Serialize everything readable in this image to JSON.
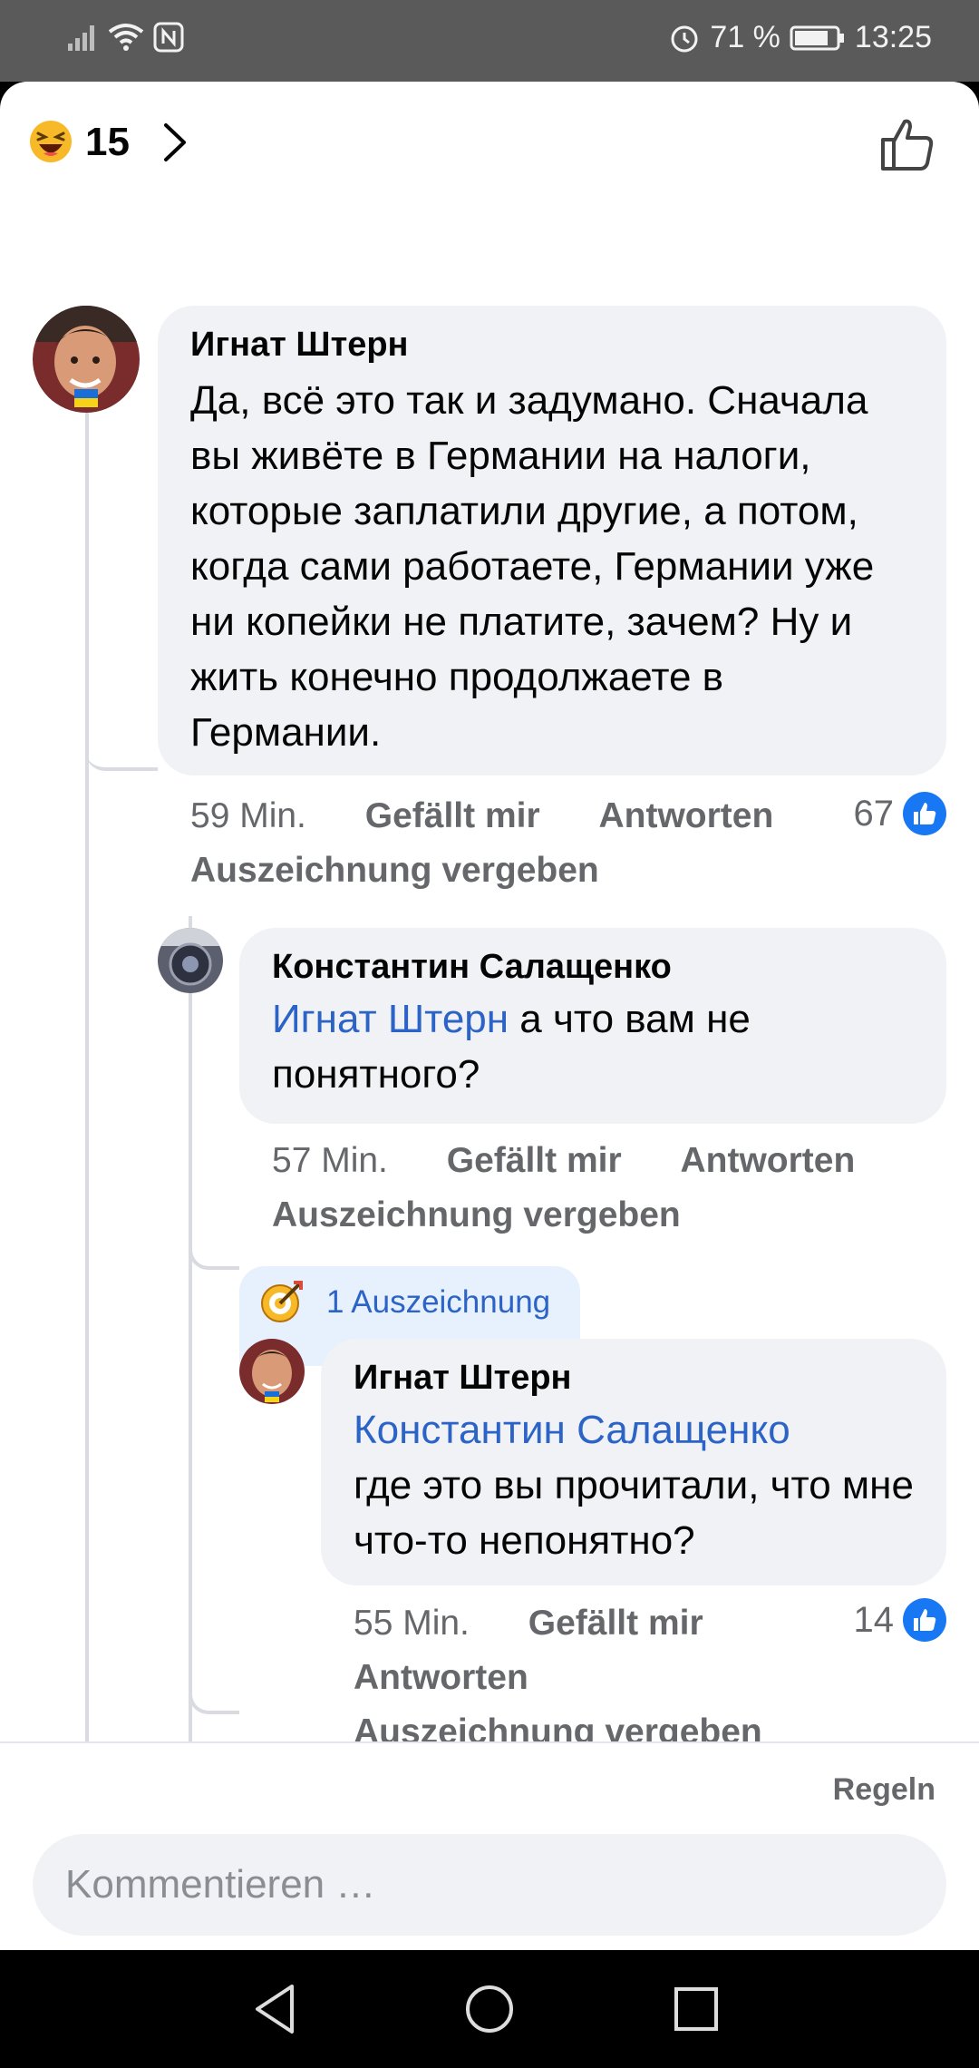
{
  "status_bar": {
    "battery": "71 %",
    "time": "13:25"
  },
  "reactions": {
    "count": "15",
    "emoji": "laughing-emoji"
  },
  "comments": [
    {
      "author": "Игнат Штерн",
      "text": "Да, всё это так и задумано. Сначала вы живёте в Германии на налоги, которые заплатили другие, а потом, когда сами работаете, Германии уже ни копейки не платите, зачем? Ну и жить конечно продолжаете в Германии.",
      "time": "59 Min.",
      "like_label": "Gefällt mir",
      "reply_label": "Antworten",
      "award_label": "Auszeichnung vergeben",
      "likes": "67"
    },
    {
      "author": "Константин Салащенко",
      "mention": "Игнат Штерн",
      "text": " а что вам не понятного?",
      "time": "57 Min.",
      "like_label": "Gefällt mir",
      "reply_label": "Antworten",
      "award_label": "Auszeichnung vergeben"
    },
    {
      "award_badge": "1 Auszeichnung",
      "author": "Игнат Штерн",
      "mention": "Константин Салащенко",
      "text": "где это вы прочитали, что мне что-то непонятно?",
      "time": "55 Min.",
      "like_label": "Gefällt mir",
      "reply_label": "Antworten",
      "award_label": "Auszeichnung vergeben",
      "likes": "14"
    }
  ],
  "footer": {
    "rules_label": "Regeln",
    "input_placeholder": "Kommentieren …"
  },
  "colors": {
    "link": "#2c63c7",
    "like_blue": "#1877f2",
    "bubble": "#f0f2f5",
    "muted": "#65676b"
  }
}
